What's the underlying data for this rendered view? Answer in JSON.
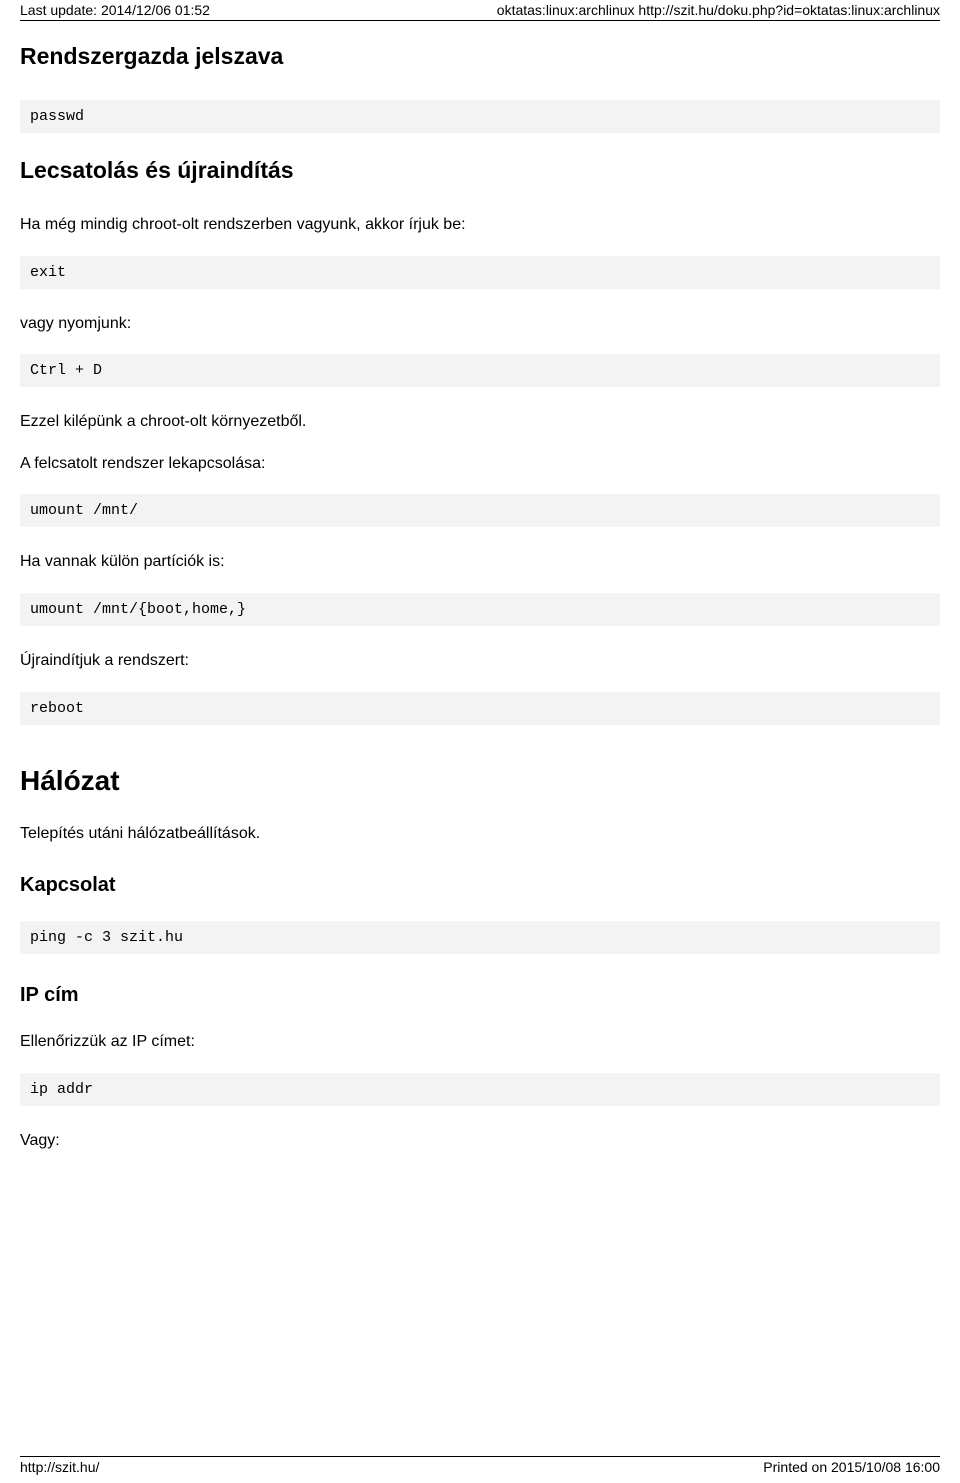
{
  "header": {
    "left": "Last update: 2014/12/06 01:52",
    "right": "oktatas:linux:archlinux http://szit.hu/doku.php?id=oktatas:linux:archlinux"
  },
  "sections": {
    "h1a": "Rendszergazda jelszava",
    "code_passwd": "passwd",
    "h1b": "Lecsatolás és újraindítás",
    "p1": "Ha még mindig chroot-olt rendszerben vagyunk, akkor írjuk be:",
    "code_exit": "exit",
    "p2": "vagy nyomjunk:",
    "code_ctrl": "Ctrl + D",
    "p3": "Ezzel kilépünk a chroot-olt környezetből.",
    "p4": "A felcsatolt rendszer lekapcsolása:",
    "code_umount1": "umount /mnt/",
    "p5": "Ha vannak külön partíciók is:",
    "code_umount2": "umount /mnt/{boot,home,}",
    "p6": "Újraindítjuk a rendszert:",
    "code_reboot": "reboot",
    "h2": "Hálózat",
    "p7": "Telepítés utáni hálózatbeállítások.",
    "h3a": "Kapcsolat",
    "code_ping": "ping -c 3 szit.hu",
    "h3b": "IP cím",
    "p8": "Ellenőrizzük az IP címet:",
    "code_ip": "ip addr",
    "p9": "Vagy:"
  },
  "footer": {
    "left": "http://szit.hu/",
    "right": "Printed on 2015/10/08 16:00"
  }
}
